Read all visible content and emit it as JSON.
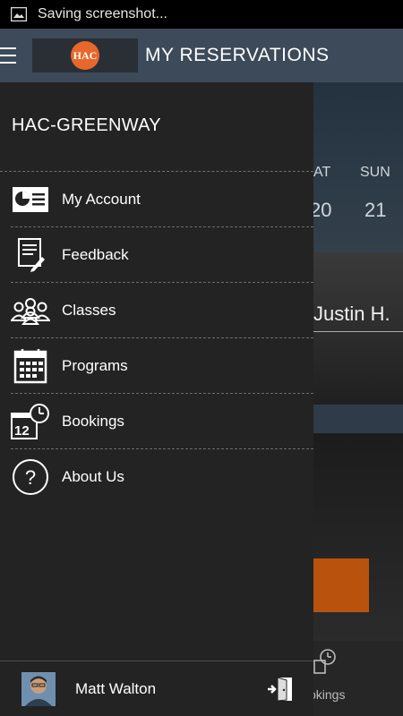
{
  "status_bar": {
    "text": "Saving screenshot..."
  },
  "app_bar": {
    "title": "MY RESERVATIONS",
    "logo_text": "HAC"
  },
  "background": {
    "days": [
      "AT",
      "SUN"
    ],
    "dates": [
      "20",
      "21"
    ],
    "instructor": "Justin H.",
    "bookings_label": "okings"
  },
  "drawer": {
    "brand": "HAC-GREENWAY",
    "items": [
      {
        "label": "My Account",
        "icon": "account-card-icon"
      },
      {
        "label": "Feedback",
        "icon": "feedback-icon"
      },
      {
        "label": "Classes",
        "icon": "group-icon"
      },
      {
        "label": "Programs",
        "icon": "calendar-icon"
      },
      {
        "label": "Bookings",
        "icon": "calendar-clock-icon",
        "calendar_number": "12"
      },
      {
        "label": "About Us",
        "icon": "question-icon"
      }
    ],
    "user": {
      "name": "Matt Walton"
    }
  },
  "colors": {
    "appbar": "#3c4a5a",
    "drawer": "#232323",
    "accent": "#e8672a"
  }
}
